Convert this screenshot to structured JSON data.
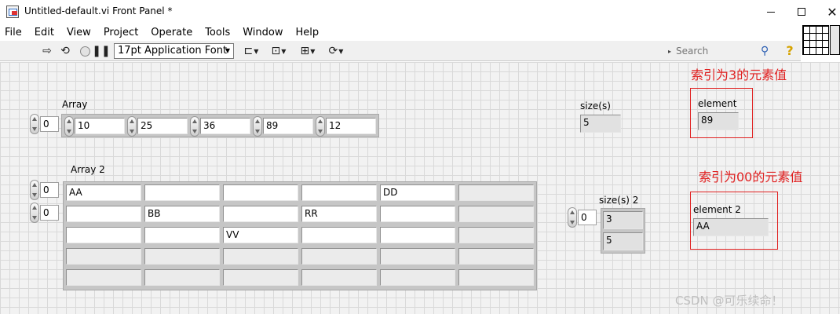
{
  "window": {
    "title": "Untitled-default.vi Front Panel *",
    "minimize": "",
    "close": "✕"
  },
  "menu": [
    "File",
    "Edit",
    "View",
    "Project",
    "Operate",
    "Tools",
    "Window",
    "Help"
  ],
  "toolbar": {
    "font_select": "17pt Application Font",
    "search_placeholder": "Search"
  },
  "panel": {
    "array": {
      "label": "Array",
      "index": "0",
      "values": [
        "10",
        "25",
        "36",
        "89",
        "12"
      ]
    },
    "size": {
      "label": "size(s)",
      "value": "5"
    },
    "element": {
      "label": "element",
      "value": "89"
    },
    "annotation1": "索引为3的元素值",
    "array2": {
      "label": "Array 2",
      "row_index": "0",
      "col_index": "0",
      "rows": [
        [
          "AA",
          "",
          "",
          "",
          "DD",
          ""
        ],
        [
          "",
          "BB",
          "",
          "RR",
          "",
          ""
        ],
        [
          "",
          "",
          "VV",
          "",
          "",
          ""
        ],
        [
          "",
          "",
          "",
          "",
          "",
          ""
        ],
        [
          "",
          "",
          "",
          "",
          "",
          ""
        ]
      ]
    },
    "size2": {
      "label": "size(s) 2",
      "index": "0",
      "values": [
        "3",
        "5"
      ]
    },
    "element2": {
      "label": "element 2",
      "value": "AA"
    },
    "annotation2": "索引为00的元素值",
    "watermark": "CSDN @可乐续命！"
  }
}
